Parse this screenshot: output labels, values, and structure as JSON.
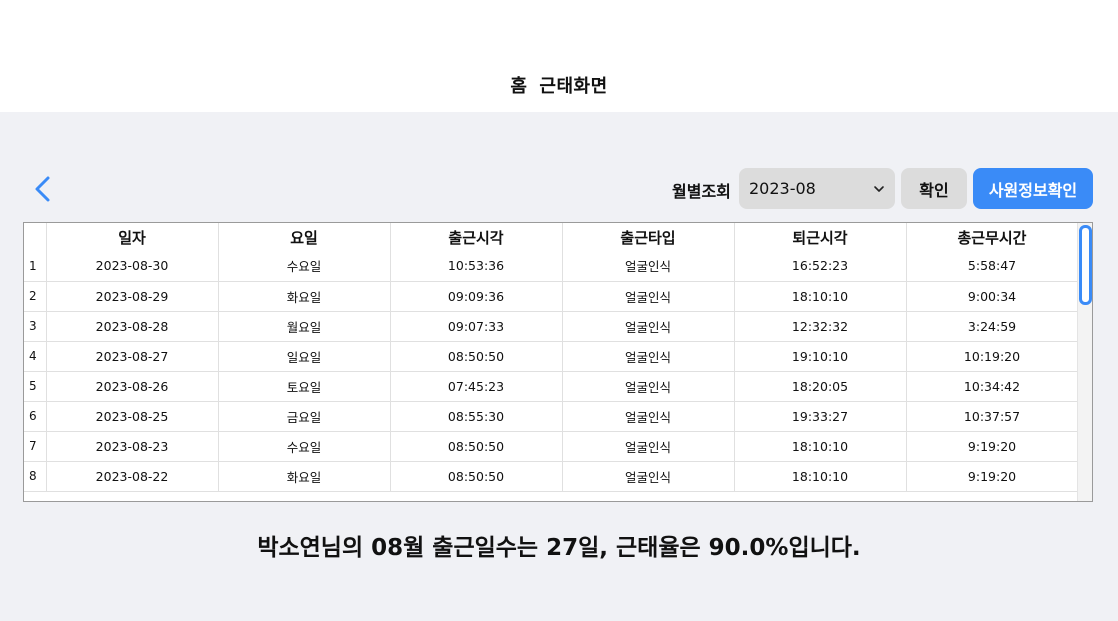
{
  "header": {
    "home": "홈",
    "title": "근태화면"
  },
  "toolbar": {
    "label": "월별조회",
    "selected_month": "2023-08",
    "confirm_label": "확인",
    "employee_label": "사원정보확인"
  },
  "table": {
    "columns": [
      "일자",
      "요일",
      "출근시각",
      "출근타입",
      "퇴근시각",
      "총근무시간"
    ],
    "rows": [
      {
        "idx": "1",
        "date": "2023-08-30",
        "day": "수요일",
        "in": "10:53:36",
        "type": "얼굴인식",
        "out": "16:52:23",
        "total": "5:58:47"
      },
      {
        "idx": "2",
        "date": "2023-08-29",
        "day": "화요일",
        "in": "09:09:36",
        "type": "얼굴인식",
        "out": "18:10:10",
        "total": "9:00:34"
      },
      {
        "idx": "3",
        "date": "2023-08-28",
        "day": "월요일",
        "in": "09:07:33",
        "type": "얼굴인식",
        "out": "12:32:32",
        "total": "3:24:59"
      },
      {
        "idx": "4",
        "date": "2023-08-27",
        "day": "일요일",
        "in": "08:50:50",
        "type": "얼굴인식",
        "out": "19:10:10",
        "total": "10:19:20"
      },
      {
        "idx": "5",
        "date": "2023-08-26",
        "day": "토요일",
        "in": "07:45:23",
        "type": "얼굴인식",
        "out": "18:20:05",
        "total": "10:34:42"
      },
      {
        "idx": "6",
        "date": "2023-08-25",
        "day": "금요일",
        "in": "08:55:30",
        "type": "얼굴인식",
        "out": "19:33:27",
        "total": "10:37:57"
      },
      {
        "idx": "7",
        "date": "2023-08-23",
        "day": "수요일",
        "in": "08:50:50",
        "type": "얼굴인식",
        "out": "18:10:10",
        "total": "9:19:20"
      },
      {
        "idx": "8",
        "date": "2023-08-22",
        "day": "화요일",
        "in": "08:50:50",
        "type": "얼굴인식",
        "out": "18:10:10",
        "total": "9:19:20"
      }
    ]
  },
  "summary": "박소연님의 08월 출근일수는 27일, 근태율은 90.0%입니다.",
  "colors": {
    "accent": "#3a8bf7",
    "button_gray": "#dcdcdc",
    "background": "#f0f1f5"
  }
}
